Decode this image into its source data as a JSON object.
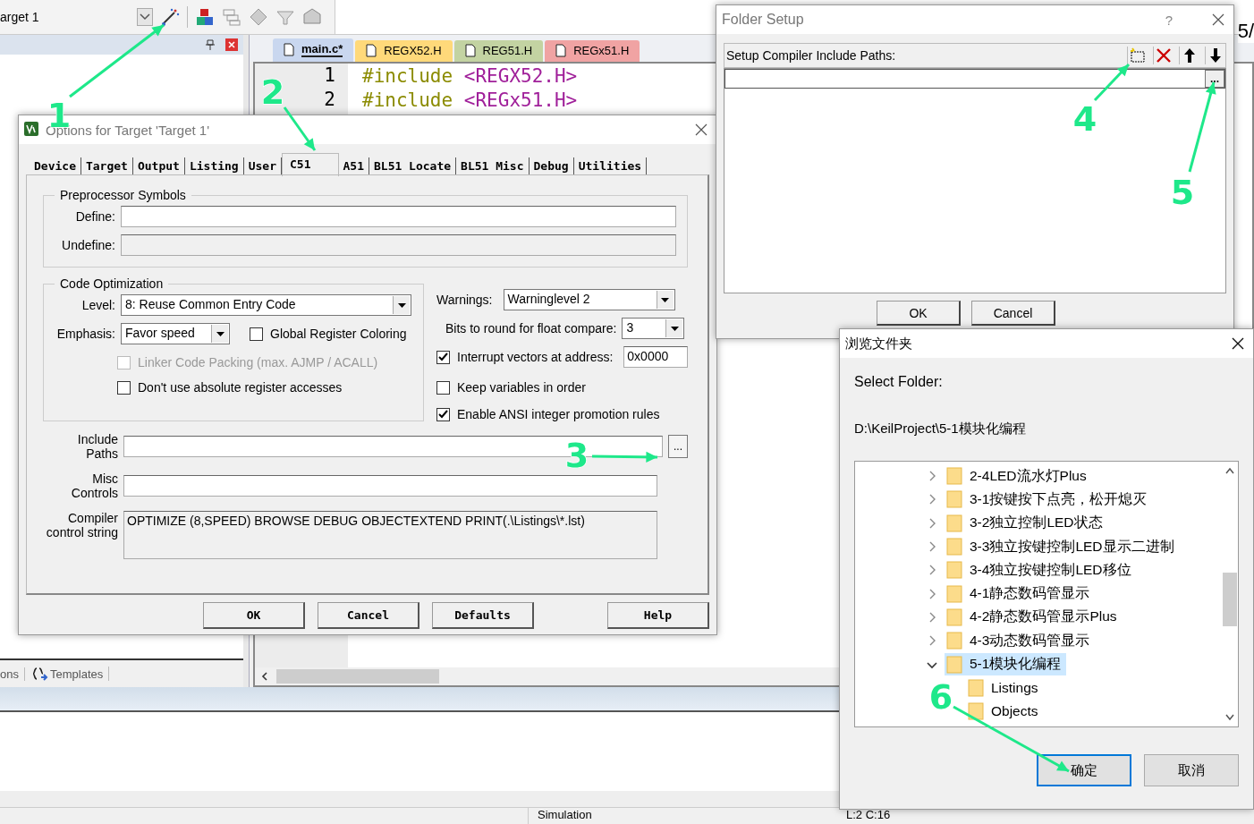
{
  "ide": {
    "target": "arget 1",
    "edge_text": "5/",
    "editor_tabs": [
      {
        "label": "main.c*",
        "selected": true,
        "color": "#c9d7ef"
      },
      {
        "label": "REGX52.H",
        "selected": false,
        "color": "#ffd97a"
      },
      {
        "label": "REG51.H",
        "selected": false,
        "color": "#c3d3a2"
      },
      {
        "label": "REGx51.H",
        "selected": false,
        "color": "#f0a3a3"
      }
    ],
    "code_lines": [
      {
        "number": "1",
        "keyword": "#include",
        "header": "<REGX52.H>"
      },
      {
        "number": "2",
        "keyword": "#include",
        "header": "<REGx51.H>"
      }
    ],
    "panel_tabs": [
      {
        "label": "ons"
      },
      {
        "label": "Templates"
      }
    ],
    "status": [
      "Simulation",
      "L:2 C:16"
    ]
  },
  "options_dialog": {
    "title": "Options for Target 'Target 1'",
    "tabs": [
      {
        "label": "Device",
        "selected": false
      },
      {
        "label": "Target",
        "selected": false
      },
      {
        "label": "Output",
        "selected": false
      },
      {
        "label": "Listing",
        "selected": false
      },
      {
        "label": "User",
        "selected": false
      },
      {
        "label": "C51",
        "selected": true
      },
      {
        "label": "A51",
        "selected": false
      },
      {
        "label": "BL51 Locate",
        "selected": false
      },
      {
        "label": "BL51 Misc",
        "selected": false
      },
      {
        "label": "Debug",
        "selected": false
      },
      {
        "label": "Utilities",
        "selected": false
      }
    ],
    "preprocessor": {
      "title": "Preprocessor Symbols",
      "define_label": "Define:",
      "undefine_label": "Undefine:"
    },
    "optimization": {
      "title": "Code Optimization",
      "level_label": "Level:",
      "level": "8: Reuse Common Entry Code",
      "emphasis_label": "Emphasis:",
      "emphasis": "Favor speed",
      "global_register": {
        "label": "Global Register Coloring",
        "checked": false
      },
      "options": [
        {
          "label": "Linker Code Packing (max. AJMP / ACALL)",
          "checked": false,
          "disabled": true
        },
        {
          "label": "Don't use absolute register accesses",
          "checked": false,
          "disabled": false
        }
      ]
    },
    "warnings_label": "Warnings:",
    "warnings": "Warninglevel 2",
    "bits_label": "Bits to round for float compare:",
    "bits": "3",
    "interrupt": {
      "label": "Interrupt vectors at address:",
      "checked": true,
      "address": "0x0000"
    },
    "right_options": [
      {
        "label": "Keep variables in order",
        "checked": false
      },
      {
        "label": "Enable ANSI integer promotion rules",
        "checked": true
      }
    ],
    "include_label": "Include Paths",
    "browse": "...",
    "misc_label": "Misc Controls",
    "control_label": "Compiler control string",
    "control_string": "OPTIMIZE (8,SPEED) BROWSE DEBUG OBJECTEXTEND PRINT(.\\Listings\\*.lst)",
    "buttons": [
      "OK",
      "Cancel",
      "Defaults",
      "Help"
    ]
  },
  "folder_setup": {
    "title": "Folder Setup",
    "help": "?",
    "header": "Setup Compiler Include Paths:",
    "browse": "...",
    "buttons": [
      "OK",
      "Cancel"
    ]
  },
  "browse_dialog": {
    "title": "浏览文件夹",
    "prompt": "Select Folder:",
    "path": "D:\\KeilProject\\5-1模块化编程",
    "tree": [
      {
        "label": "2-4LED流水灯Plus",
        "expanded": false,
        "selected": false
      },
      {
        "label": "3-1按键按下点亮，松开熄灭",
        "expanded": false,
        "selected": false
      },
      {
        "label": "3-2独立控制LED状态",
        "expanded": false,
        "selected": false
      },
      {
        "label": "3-3独立按键控制LED显示二进制",
        "expanded": false,
        "selected": false
      },
      {
        "label": "3-4独立按键控制LED移位",
        "expanded": false,
        "selected": false
      },
      {
        "label": "4-1静态数码管显示",
        "expanded": false,
        "selected": false
      },
      {
        "label": "4-2静态数码管显示Plus",
        "expanded": false,
        "selected": false
      },
      {
        "label": "4-3动态数码管显示",
        "expanded": false,
        "selected": false
      },
      {
        "label": "5-1模块化编程",
        "expanded": true,
        "selected": true,
        "children": [
          {
            "label": "Listings",
            "selected": false
          },
          {
            "label": "Objects",
            "selected": false
          }
        ]
      }
    ],
    "buttons": [
      "确定",
      "取消"
    ]
  },
  "annotations": [
    {
      "label": "1"
    },
    {
      "label": "2"
    },
    {
      "label": "3"
    },
    {
      "label": "4"
    },
    {
      "label": "5"
    },
    {
      "label": "6"
    }
  ]
}
